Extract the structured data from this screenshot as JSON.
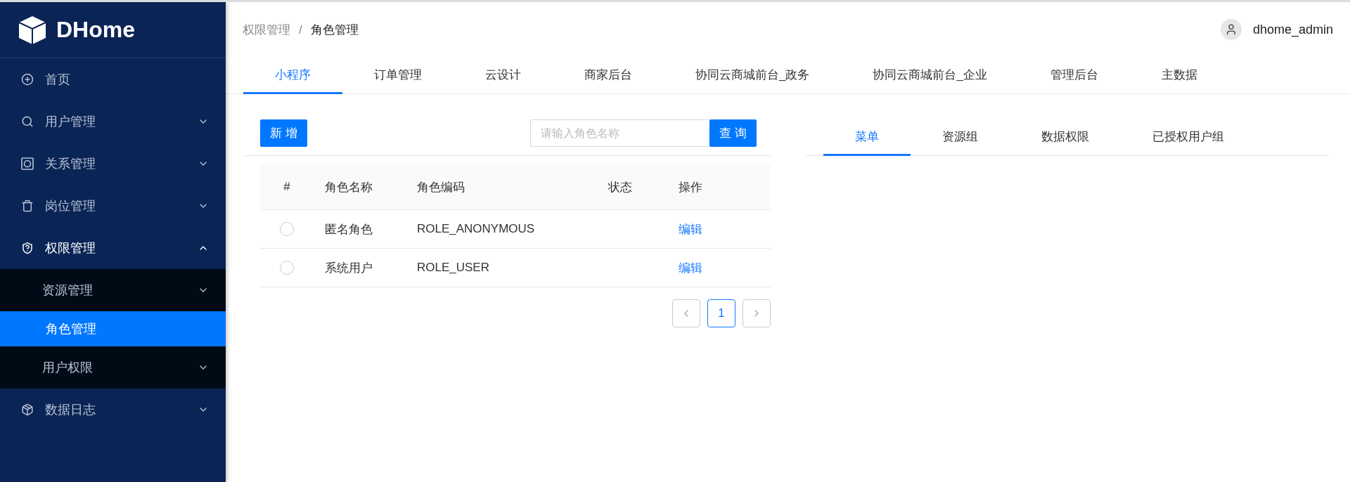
{
  "sidebar": {
    "logo_text": "DHome",
    "items": [
      {
        "label": "首页",
        "kind": "link",
        "selected": false
      },
      {
        "label": "用户管理",
        "kind": "group",
        "expanded": false,
        "selected": false
      },
      {
        "label": "关系管理",
        "kind": "group",
        "expanded": false,
        "selected": false
      },
      {
        "label": "岗位管理",
        "kind": "group",
        "expanded": false,
        "selected": false
      },
      {
        "label": "权限管理",
        "kind": "group",
        "expanded": true,
        "selected": false,
        "children": [
          {
            "label": "资源管理",
            "kind": "group",
            "expanded": false,
            "selected": false
          },
          {
            "label": "角色管理",
            "kind": "link",
            "selected": true
          },
          {
            "label": "用户权限",
            "kind": "group",
            "expanded": false,
            "selected": false
          }
        ]
      },
      {
        "label": "数据日志",
        "kind": "group",
        "expanded": false,
        "selected": false
      }
    ]
  },
  "header": {
    "breadcrumb": [
      "权限管理",
      "角色管理"
    ],
    "breadcrumb_separator": "/",
    "user": "dhome_admin"
  },
  "tabs": [
    {
      "label": "小程序",
      "selected": true
    },
    {
      "label": "订单管理",
      "selected": false
    },
    {
      "label": "云设计",
      "selected": false
    },
    {
      "label": "商家后台",
      "selected": false
    },
    {
      "label": "协同云商城前台_政务",
      "selected": false
    },
    {
      "label": "协同云商城前台_企业",
      "selected": false
    },
    {
      "label": "管理后台",
      "selected": false
    },
    {
      "label": "主数据",
      "selected": false
    }
  ],
  "roles": {
    "add_button": "新 增",
    "search": {
      "placeholder": "请输入角色名称"
    },
    "search_button": "查 询",
    "table": {
      "columns": [
        "#",
        "角色名称",
        "角色编码",
        "状态",
        "操作"
      ],
      "rows": [
        {
          "selected": false,
          "name": "匿名角色",
          "code": "ROLE_ANONYMOUS",
          "action": "编辑"
        },
        {
          "selected": false,
          "name": "系统用户",
          "code": "ROLE_USER",
          "action": "编辑"
        }
      ]
    },
    "pagination": {
      "pages": [
        {
          "label": "1",
          "selected": true
        }
      ]
    }
  },
  "detail_tabs": [
    {
      "label": "菜单",
      "selected": true
    },
    {
      "label": "资源组",
      "selected": false
    },
    {
      "label": "数据权限",
      "selected": false
    },
    {
      "label": "已授权用户组",
      "selected": false
    }
  ]
}
